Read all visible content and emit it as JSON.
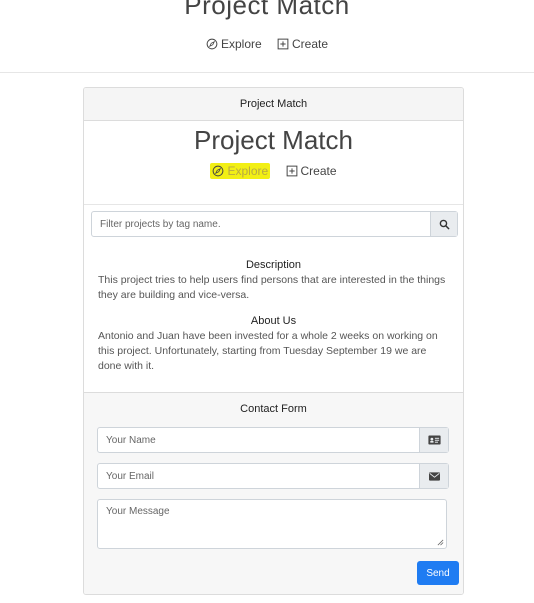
{
  "header": {
    "title": "Project Match",
    "nav": {
      "explore": "Explore",
      "create": "Create"
    }
  },
  "card": {
    "header": "Project Match",
    "title": "Project Match",
    "nav": {
      "explore": "Explore",
      "create": "Create"
    },
    "search": {
      "placeholder": "Filter projects by tag name."
    },
    "description": {
      "heading": "Description",
      "text": "This project tries to help users find persons that are interested in the things they are building and vice-versa."
    },
    "about": {
      "heading": "About Us",
      "text": "Antonio and Juan have been invested for a whole 2 weeks on working on this project. Unfortunately, starting from Tuesday September 19 we are done with it."
    },
    "contact": {
      "heading": "Contact Form",
      "name_placeholder": "Your Name",
      "email_placeholder": "Your Email",
      "message_placeholder": "Your Message",
      "send_label": "Send"
    }
  },
  "colors": {
    "highlight": "#f2ef14",
    "send_button": "#1f7cf2",
    "text": "#333333"
  },
  "icons": [
    "compass-icon",
    "plus-square-icon",
    "search-icon",
    "id-card-icon",
    "envelope-icon"
  ]
}
